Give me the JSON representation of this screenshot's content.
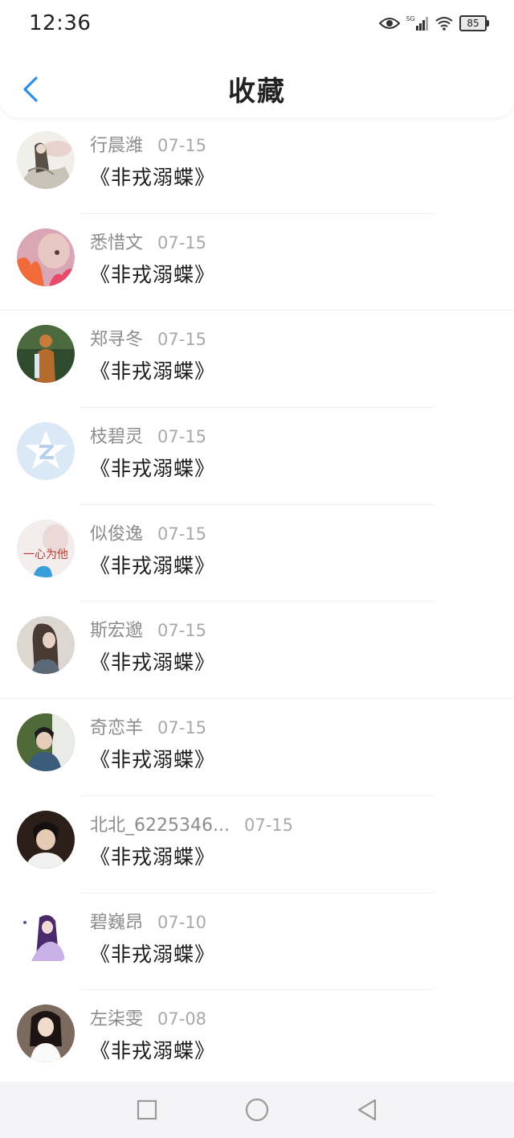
{
  "status_bar": {
    "time": "12:36",
    "network": "5G",
    "battery": "85",
    "icons": [
      "eye-icon",
      "signal-icon",
      "wifi-icon",
      "battery-icon"
    ]
  },
  "header": {
    "title": "收藏",
    "back_icon": "chevron-left-icon",
    "accent": "#2f8fe8"
  },
  "items": [
    {
      "name": "行晨潍",
      "date": "07-15",
      "book": "《非戎溺蝶》",
      "avatar": "ink-painting"
    },
    {
      "name": "悉惜文",
      "date": "07-15",
      "book": "《非戎溺蝶》",
      "avatar": "pink-fire"
    },
    {
      "name": "郑寻冬",
      "date": "07-15",
      "book": "《非戎溺蝶》",
      "avatar": "forest-figure"
    },
    {
      "name": "枝碧灵",
      "date": "07-15",
      "book": "《非戎溺蝶》",
      "avatar": "qq-default"
    },
    {
      "name": "似俊逸",
      "date": "07-15",
      "book": "《非戎溺蝶》",
      "avatar": "text-avatar",
      "avatar_text": "一心为他"
    },
    {
      "name": "斯宏邈",
      "date": "07-15",
      "book": "《非戎溺蝶》",
      "avatar": "girl-side"
    },
    {
      "name": "奇恋羊",
      "date": "07-15",
      "book": "《非戎溺蝶》",
      "avatar": "boy-photo"
    },
    {
      "name": "北北_6225346...",
      "date": "07-15",
      "book": "《非戎溺蝶》",
      "avatar": "dark-portrait"
    },
    {
      "name": "碧巍昂",
      "date": "07-10",
      "book": "《非戎溺蝶》",
      "avatar": "anime-purple"
    },
    {
      "name": "左柒雯",
      "date": "07-08",
      "book": "《非戎溺蝶》",
      "avatar": "girl-white"
    }
  ],
  "navbar": {
    "buttons": [
      "recent-apps-icon",
      "home-icon",
      "back-icon"
    ]
  }
}
